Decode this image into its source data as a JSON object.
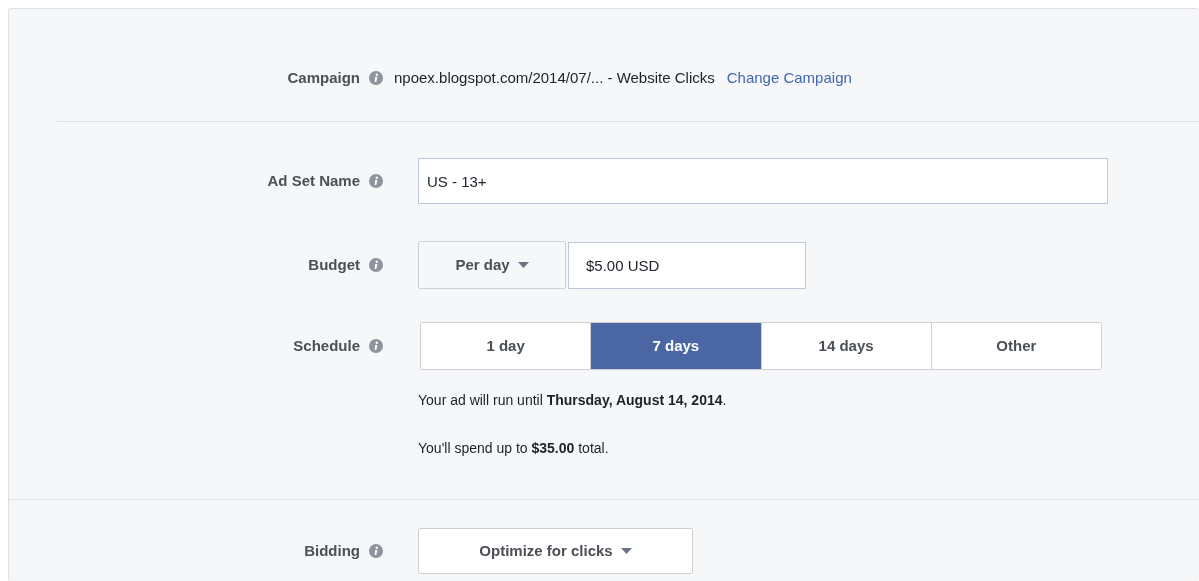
{
  "campaign": {
    "label": "Campaign",
    "value": "npoex.blogspot.com/2014/07/... - Website Clicks",
    "link": "Change Campaign"
  },
  "ad_set_name": {
    "label": "Ad Set Name",
    "value": "US - 13+"
  },
  "budget": {
    "label": "Budget",
    "period": "Per day",
    "value": "$5.00 USD"
  },
  "schedule": {
    "label": "Schedule",
    "options": [
      {
        "label": "1 day",
        "selected": false
      },
      {
        "label": "7 days",
        "selected": true
      },
      {
        "label": "14 days",
        "selected": false
      },
      {
        "label": "Other",
        "selected": false
      }
    ],
    "notes": [
      "Your ad will run until **Thursday, August 14, 2014**.",
      "You'll spend up to **$35.00** total."
    ]
  },
  "bidding": {
    "label": "Bidding",
    "value": "Optimize for clicks"
  }
}
